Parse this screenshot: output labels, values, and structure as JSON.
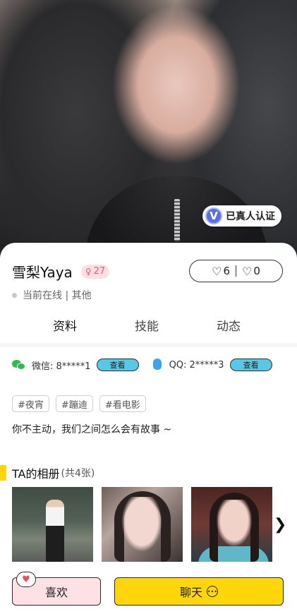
{
  "profile": {
    "verified_label": "已真人认证",
    "name": "雪梨Yaya",
    "age": "27",
    "likes": "6",
    "dislikes": "0",
    "status": "当前在线 | 其他"
  },
  "tabs": [
    "资料",
    "技能",
    "动态"
  ],
  "contacts": {
    "wechat_label": "微信: 8*****1",
    "qq_label": "QQ: 2*****3",
    "view_label": "查看"
  },
  "tags": [
    "#夜宵",
    "#蹦迪",
    "#看电影"
  ],
  "bio": "你不主动，我们之间怎么会有故事 ~",
  "album": {
    "title": "TA的相册",
    "count": "(共4张)"
  },
  "actions": {
    "like_label": "喜欢",
    "chat_label": "聊天"
  },
  "colors": {
    "accent_yellow": "#ffd60a",
    "like_pink": "#fde1e4",
    "view_blue": "#59c7e6"
  }
}
